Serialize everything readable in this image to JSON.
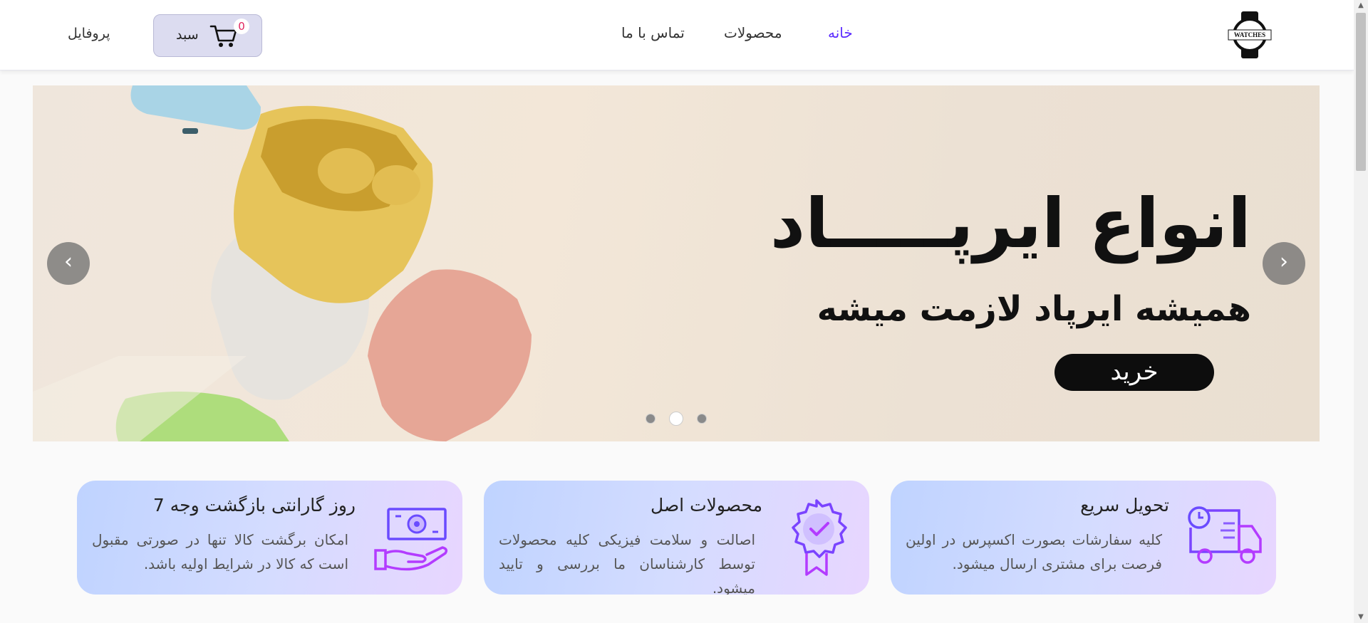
{
  "header": {
    "logo_text": "WATCHES",
    "nav": {
      "home": "خانه",
      "products": "محصولات",
      "contact": "تماس با ما"
    },
    "cart": {
      "label": "سبد",
      "count": "0"
    },
    "profile": "پروفایل"
  },
  "slider": {
    "title": "انواع ایرپـــــاد",
    "subtitle": "همیشه ایرپاد لازمت میشه",
    "buy_label": "خرید",
    "prev_arrow": "‹",
    "next_arrow": "›",
    "dots": 3,
    "active_dot": 2
  },
  "features": [
    {
      "title": "تحویل سریع",
      "text": "کلیه سفارشات بصورت اکسپرس در اولین فرصت برای مشتری ارسال میشود.",
      "icon": "delivery-truck-icon"
    },
    {
      "title": "محصولات اصل",
      "text": "اصالت و سلامت فیزیکی کلیه محصولات توسط کارشناسان ما بررسی و تایید میشود.",
      "icon": "badge-check-icon"
    },
    {
      "title": "7 روز گارانتی بازگشت وجه",
      "text": "امکان برگشت کالا تنها در صورتی مقبول است که کالا در شرایط اولیه باشد.",
      "icon": "money-hand-icon"
    }
  ],
  "colors": {
    "accent": "#5b2bff",
    "card_from": "#bfd3ff",
    "card_to": "#e8d6ff",
    "icon_stroke": "#7b3cff"
  }
}
